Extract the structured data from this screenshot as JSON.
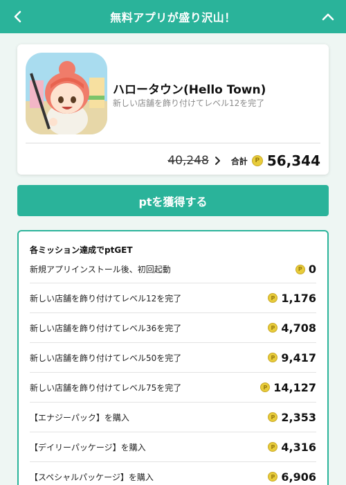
{
  "header": {
    "title": "無料アプリが盛り沢山！",
    "back_icon": "chevron-left-icon",
    "collapse_icon": "chevron-up-icon"
  },
  "app": {
    "name": "ハロータウン(Hello Town)",
    "description": "新しい店舗を飾り付けてレベル12を完了",
    "old_points": "40,248",
    "total_label": "合計",
    "total_points": "56,344"
  },
  "cta": {
    "label": "ptを獲得する"
  },
  "missions": {
    "title": "各ミッション達成でptGET",
    "items": [
      {
        "name": "新規アプリインストール後、初回起動",
        "points": "0"
      },
      {
        "name": "新しい店舗を飾り付けてレベル12を完了",
        "points": "1,176"
      },
      {
        "name": "新しい店舗を飾り付けてレベル36を完了",
        "points": "4,708"
      },
      {
        "name": "新しい店舗を飾り付けてレベル50を完了",
        "points": "9,417"
      },
      {
        "name": "新しい店舗を飾り付けてレベル75を完了",
        "points": "14,127"
      },
      {
        "name": "【エナジーパック】を購入",
        "points": "2,353"
      },
      {
        "name": "【デイリーパッケージ】を購入",
        "points": "4,316"
      },
      {
        "name": "【スペシャルパッケージ】を購入",
        "points": "6,906"
      }
    ]
  },
  "colors": {
    "accent": "#2ab39a",
    "coin": "#e8cc3a"
  }
}
